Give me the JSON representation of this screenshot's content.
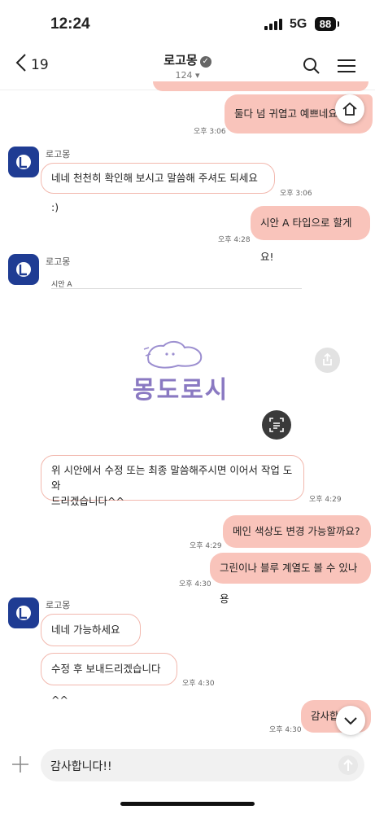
{
  "status_bar": {
    "time": "12:24",
    "network": "5G",
    "battery": "88"
  },
  "header": {
    "back_count": "19",
    "title": "로고몽",
    "member_count": "124 ▾"
  },
  "messages": [
    {
      "text": "둘다 넘 귀엽고 예쁘네요",
      "time": "오후 3:06"
    },
    {
      "sender": "로고몽",
      "text": "네네 천천히 확인해 보시고 말씀해 주셔도 되세요 :)",
      "time": "오후 3:06"
    },
    {
      "text": "시안 A 타입으로 할게요!",
      "time": "오후 4:28"
    },
    {
      "sender": "로고몽",
      "card_label": "시안 A",
      "card_logo_text": "몽도로시"
    },
    {
      "text_line1": "위 시안에서 수정 또는 최종 말씀해주시면 이어서 작업 도와",
      "text_line2": "드리겠습니다^^",
      "time": "오후 4:29"
    },
    {
      "text": "메인 색상도 변경 가능할까요?",
      "time": "오후 4:29"
    },
    {
      "text": "그린이나 블루 계열도 볼 수 있나용",
      "time": "오후 4:30"
    },
    {
      "sender": "로고몽",
      "text": "네네 가능하세요 :)"
    },
    {
      "text": "수정 후 보내드리겠습니다 ^^",
      "time": "오후 4:30"
    },
    {
      "text": "감사합",
      "time": "오후 4:30"
    }
  ],
  "composer": {
    "value": "감사합니다!!"
  },
  "colors": {
    "outgoing": "#f9c4bb",
    "incoming_border": "#f2b8ae",
    "avatar": "#1f3c93",
    "logo": "#8a79c2"
  }
}
